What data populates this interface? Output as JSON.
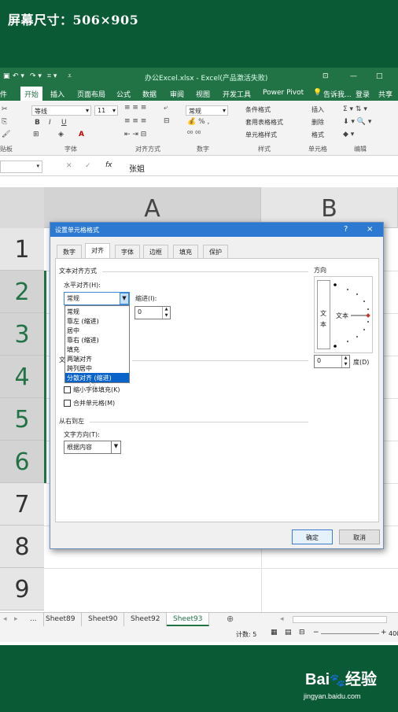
{
  "caption": "屏幕尺寸：506×905",
  "window": {
    "title": "办公Excel.xlsx - Excel(产品激活失败)",
    "help": "?",
    "tell_me": "告诉我...",
    "login": "登录",
    "share": "共享"
  },
  "ribbon_tabs": [
    "件",
    "开始",
    "插入",
    "页面布局",
    "公式",
    "数据",
    "审阅",
    "视图",
    "开发工具",
    "Power Pivot"
  ],
  "ribbon": {
    "font_name": "等线",
    "font_size": "11",
    "number_format": "常规",
    "bold": "B",
    "italic": "I",
    "underline": "U",
    "groups": [
      "贴板",
      "字体",
      "对齐方式",
      "数字",
      "样式",
      "单元格",
      "编辑"
    ],
    "style_buttons": [
      "条件格式",
      "套用表格格式",
      "单元格样式"
    ],
    "cell_buttons": [
      "插入",
      "删除",
      "格式"
    ]
  },
  "formula_bar": {
    "fx": "fx",
    "value": "张姐"
  },
  "grid": {
    "columns": [
      "A",
      "B"
    ],
    "rows": [
      "1",
      "2",
      "3",
      "4",
      "5",
      "6",
      "7",
      "8",
      "9"
    ]
  },
  "sheets": [
    "...",
    "Sheet89",
    "Sheet90",
    "Sheet92",
    "Sheet93"
  ],
  "status": {
    "count": "计数: 5",
    "zoom": "400"
  },
  "dialog": {
    "title": "设置单元格格式",
    "help": "?",
    "close": "×",
    "tabs": [
      "数字",
      "对齐",
      "字体",
      "边框",
      "填充",
      "保护"
    ],
    "section_align": "文本对齐方式",
    "horiz_label": "水平对齐(H):",
    "horiz_value": "常规",
    "indent_label": "缩进(I):",
    "indent_value": "0",
    "dropdown_items": [
      "常规",
      "靠左 (缩进)",
      "居中",
      "靠右 (缩进)",
      "填充",
      "两端对齐",
      "跨列居中",
      "分散对齐 (缩进)"
    ],
    "text_control_partial": "文",
    "shrink_label": "缩小字体填充(K)",
    "merge_label": "合并单元格(M)",
    "rtl_section": "从右到左",
    "direction_label": "文字方向(T):",
    "direction_value": "根据内容",
    "orientation_title": "方向",
    "vertical_text": [
      "文",
      "本"
    ],
    "horizontal_text": "文本",
    "degree_value": "0",
    "degree_label": "度(D)",
    "ok": "确定",
    "cancel": "取消"
  },
  "watermark": {
    "brand": "Bai",
    "brand2": "经验",
    "url": "jingyan.baidu.com"
  }
}
